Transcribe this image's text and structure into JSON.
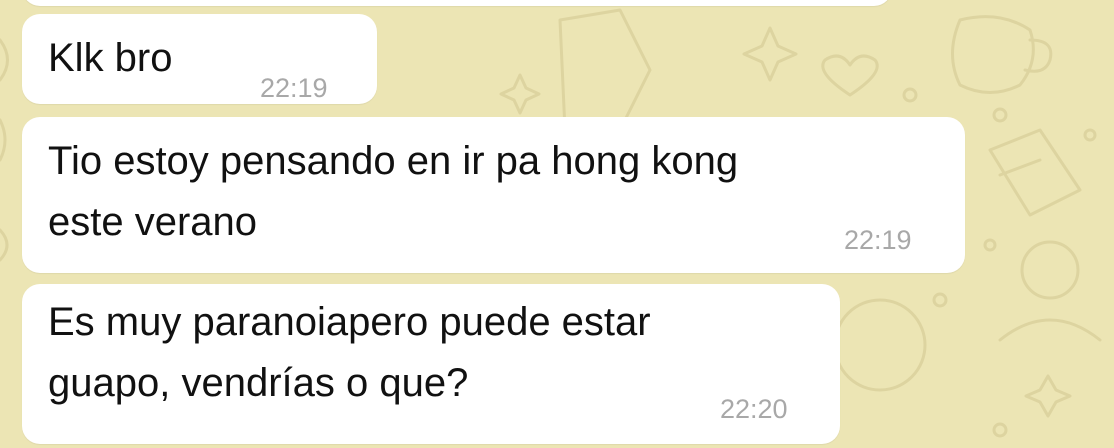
{
  "chat": {
    "background_color": "#ece5b4",
    "bubble_color": "#ffffff",
    "messages": [
      {
        "text": "Klk bro",
        "time": "22:19"
      },
      {
        "text": "Tio estoy pensando en ir pa hong kong\neste verano",
        "time": "22:19"
      },
      {
        "text": "Es muy paranoiapero puede estar\nguapo, vendrías o que?",
        "time": "22:20"
      }
    ]
  }
}
